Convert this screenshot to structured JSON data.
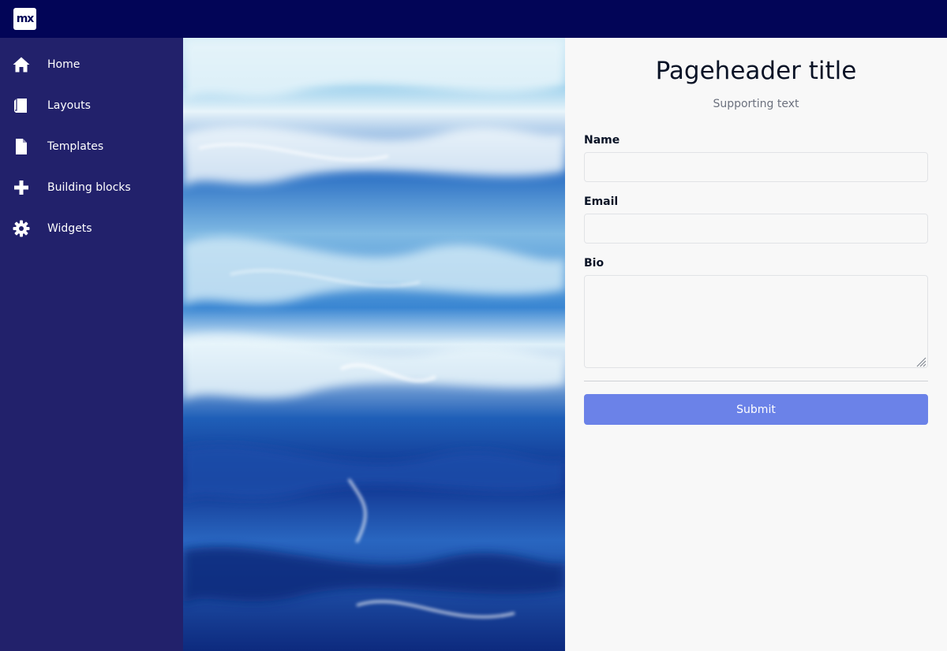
{
  "app": {
    "logo_text": "mx",
    "brand_color": "#020557",
    "sidebar_color": "#22216b"
  },
  "sidebar": {
    "items": [
      {
        "label": "Home",
        "icon": "home-icon"
      },
      {
        "label": "Layouts",
        "icon": "book-icon"
      },
      {
        "label": "Templates",
        "icon": "file-icon"
      },
      {
        "label": "Building blocks",
        "icon": "plus-icon"
      },
      {
        "label": "Widgets",
        "icon": "gear-icon"
      }
    ]
  },
  "page": {
    "title": "Pageheader title",
    "subtitle": "Supporting text"
  },
  "form": {
    "name_label": "Name",
    "name_value": "",
    "email_label": "Email",
    "email_value": "",
    "bio_label": "Bio",
    "bio_value": "",
    "submit_label": "Submit",
    "submit_color": "#6b82e8"
  }
}
